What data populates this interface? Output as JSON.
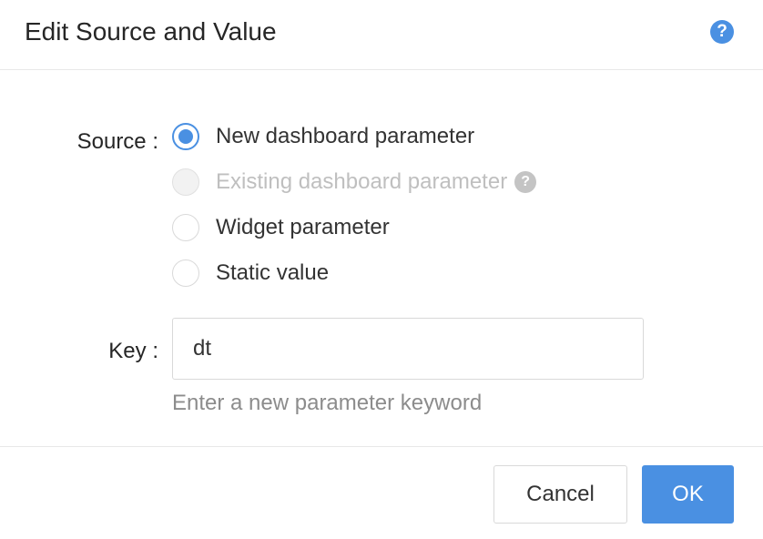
{
  "dialog": {
    "title": "Edit Source and Value",
    "help_icon": "question-circle-icon"
  },
  "form": {
    "source_label": "Source :",
    "source_options": [
      {
        "label": "New dashboard parameter",
        "checked": true,
        "disabled": false
      },
      {
        "label": "Existing dashboard parameter",
        "checked": false,
        "disabled": true
      },
      {
        "label": "Widget parameter",
        "checked": false,
        "disabled": false
      },
      {
        "label": "Static value",
        "checked": false,
        "disabled": false
      }
    ],
    "key_label": "Key :",
    "key_value": "dt",
    "key_hint": "Enter a new parameter keyword"
  },
  "footer": {
    "cancel_label": "Cancel",
    "ok_label": "OK"
  },
  "colors": {
    "accent": "#4a90e2",
    "disabled_text": "#bfbfbf",
    "hint_text": "#8c8c8c"
  }
}
